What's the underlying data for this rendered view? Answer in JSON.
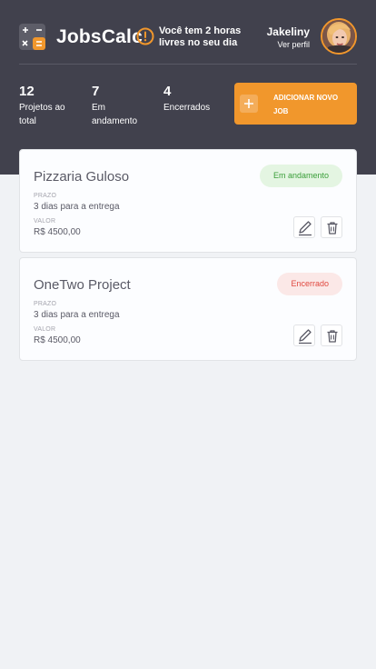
{
  "header": {
    "brand": "JobsCalc",
    "alert_text": "Você tem 2 horas livres no seu dia",
    "profile": {
      "name": "Jakeliny",
      "link": "Ver perfil"
    }
  },
  "stats": [
    {
      "value": "12",
      "label": "Projetos ao total"
    },
    {
      "value": "7",
      "label": "Em andamento"
    },
    {
      "value": "4",
      "label": "Encerrados"
    }
  ],
  "add_button": {
    "label": "Adicionar novo job"
  },
  "jobs": [
    {
      "title": "Pizzaria Guloso",
      "deadline_label": "Prazo",
      "deadline": "3 dias para a entrega",
      "value_label": "Valor",
      "value": "R$ 4500,00",
      "status": "Em andamento"
    },
    {
      "title": "OneTwo Project",
      "deadline_label": "Prazo",
      "deadline": "3 dias para a entrega",
      "value_label": "Valor",
      "value": "R$ 4500,00",
      "status": "Encerrado"
    }
  ],
  "colors": {
    "header_bg": "#41414d",
    "accent": "#f1972c",
    "status_progress": "#3a9e39",
    "status_closed": "#e0483f"
  },
  "icons": {
    "logo": "calculator-icon",
    "alert": "alert-circle-icon",
    "add": "plus-icon",
    "edit": "pencil-icon",
    "delete": "trash-icon"
  }
}
